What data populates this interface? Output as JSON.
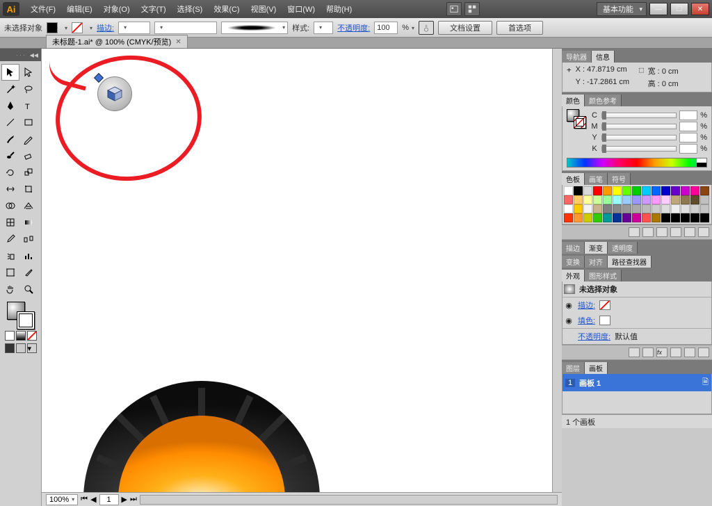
{
  "menubar": {
    "logo": "Ai",
    "items": [
      "文件(F)",
      "编辑(E)",
      "对象(O)",
      "文字(T)",
      "选择(S)",
      "效果(C)",
      "视图(V)",
      "窗口(W)",
      "帮助(H)"
    ],
    "workspace": "基本功能"
  },
  "controlbar": {
    "noSelection": "未选择对象",
    "strokeLabel": "描边:",
    "styleLabel": "样式:",
    "opacityLabel": "不透明度:",
    "opacityValue": "100",
    "opacitySuffix": "%",
    "docSetup": "文档设置",
    "prefs": "首选项"
  },
  "documentTab": {
    "title": "未标题-1.ai* @ 100% (CMYK/预览)"
  },
  "canvas": {
    "zoom": "100%",
    "page": "1"
  },
  "panels": {
    "nav": {
      "tabNav": "导航器",
      "tabInfo": "信息",
      "x": "47.8719 cm",
      "y": "-17.2861 cm",
      "w": "0 cm",
      "h": "0 cm",
      "xL": "X :",
      "yL": "Y :",
      "wL": "宽 :",
      "hL": "高 :"
    },
    "color": {
      "tabColor": "颜色",
      "tabGuide": "颜色参考",
      "channels": [
        "C",
        "M",
        "Y",
        "K"
      ],
      "pct": "%"
    },
    "swatches": {
      "tabSwatch": "色板",
      "tabBrush": "画笔",
      "tabSymbol": "符号"
    },
    "strokeRow": {
      "t1": "描边",
      "t2": "渐变",
      "t3": "透明度"
    },
    "transformRow": {
      "t1": "变换",
      "t2": "对齐",
      "t3": "路径查找器"
    },
    "appearance": {
      "tabApp": "外观",
      "tabGraphic": "图形样式",
      "header": "未选择对象",
      "stroke": "描边:",
      "fill": "填色:",
      "opacity": "不透明度:",
      "opVal": "默认值"
    },
    "layers": {
      "tabLayer": "图层",
      "tabArtboard": "画板",
      "row": {
        "idx": "1",
        "name": "画板 1"
      },
      "footer": "1 个画板"
    }
  },
  "swatchColors": [
    "#fff",
    "#000",
    "#d9d9d9",
    "#ff0000",
    "#ff9900",
    "#ffff00",
    "#66ff00",
    "#00cc00",
    "#00ccff",
    "#0066ff",
    "#0000cc",
    "#6600cc",
    "#cc00cc",
    "#ff0099",
    "#8b4513",
    "#ff6666",
    "#ffcc66",
    "#ffff99",
    "#ccff99",
    "#99ff99",
    "#99ffff",
    "#99ccff",
    "#9999ff",
    "#cc99ff",
    "#ff99ff",
    "#ffccff",
    "#bfa77b",
    "#8e7850",
    "#5e4d2d",
    "#c0c0c0",
    "#ffffff",
    "#ffcc00",
    "#f3f3f3",
    "#c9b48c",
    "#808080",
    "#8a8a8a",
    "#999999",
    "#aaaaaa",
    "#bbbbbb",
    "#cccccc",
    "#dddddd",
    "#eeeeee",
    "#e0e0e0",
    "#d0d0d0",
    "#c4c4c4",
    "#ff3300",
    "#ff9933",
    "#cccc00",
    "#33cc00",
    "#009999",
    "#003399",
    "#660099",
    "#cc0099",
    "#ff5050",
    "#aa7700",
    "#000000",
    "#000000",
    "#000000",
    "#000000",
    "#000000"
  ],
  "winButtons": {
    "min": "—",
    "max": "☐",
    "close": "✕"
  }
}
